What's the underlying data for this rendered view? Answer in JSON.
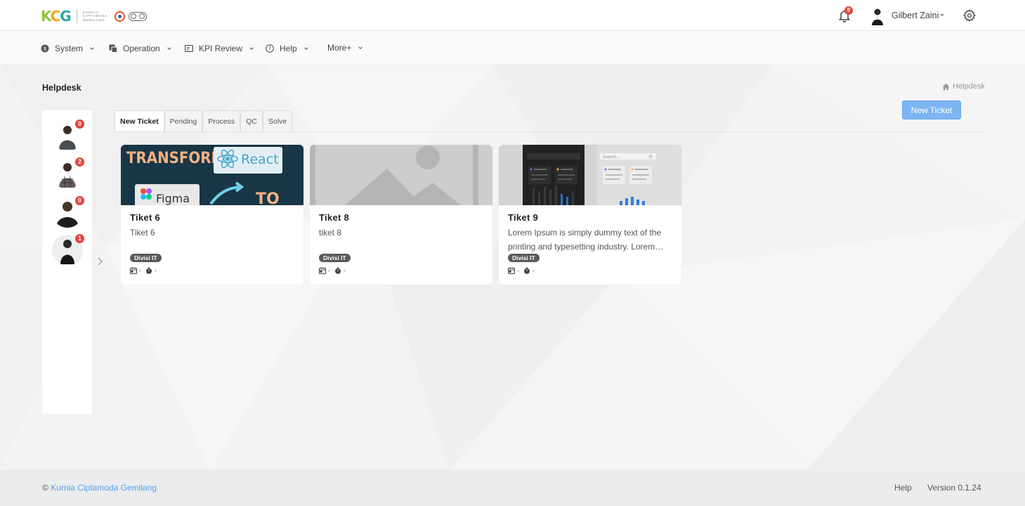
{
  "brand": {
    "logo_text": "KCG",
    "logo_subtext": "KURNIA CIPTAMODA GEMILANG"
  },
  "header": {
    "notification_count": "9",
    "user_name": "Gilbert Zaini",
    "icons": [
      "bell-icon",
      "chevron-down-icon",
      "gear-icon"
    ]
  },
  "nav": {
    "items": [
      {
        "label": "System",
        "icon": "system-icon"
      },
      {
        "label": "Operation",
        "icon": "operation-icon"
      },
      {
        "label": "KPI Review",
        "icon": "kpi-review-icon"
      },
      {
        "label": "Help",
        "icon": "help-icon"
      },
      {
        "label": "More+",
        "icon": ""
      }
    ]
  },
  "page": {
    "title": "Helpdesk",
    "breadcrumb": "Helpdesk",
    "new_ticket_button": "New Ticket"
  },
  "agents": [
    {
      "count": "0"
    },
    {
      "count": "2"
    },
    {
      "count": "0"
    },
    {
      "count": "1"
    }
  ],
  "tabs": [
    {
      "label": "New Ticket",
      "active": true
    },
    {
      "label": "Pending",
      "active": false
    },
    {
      "label": "Process",
      "active": false
    },
    {
      "label": "QC",
      "active": false
    },
    {
      "label": "Solve",
      "active": false
    }
  ],
  "tickets": [
    {
      "title": "Tiket 6",
      "description": "Tiket 6",
      "division": "Divisi IT",
      "date": "-",
      "time": "-",
      "image_text": [
        "TRANSFORM",
        "React",
        "Figma",
        "TO"
      ]
    },
    {
      "title": "Tiket 8",
      "description": "tiket 8",
      "division": "Divisi IT",
      "date": "-",
      "time": "-"
    },
    {
      "title": "Tiket 9",
      "description": "Lorem Ipsum is simply dummy text of the printing and typesetting industry. Lorem Ipsum",
      "division": "Divisi IT",
      "date": "-",
      "time": "-",
      "image_text": [
        "Search..."
      ]
    }
  ],
  "footer": {
    "copyright_symbol": "©",
    "company": "Kurnia Ciptamoda Gemilang",
    "help": "Help",
    "version": "Version 0.1.24"
  },
  "colors": {
    "primary_button": "#7cb5f3",
    "badge_red": "#e4443b",
    "link": "#5b9ee8",
    "tag_bg": "#5a5a5a"
  }
}
